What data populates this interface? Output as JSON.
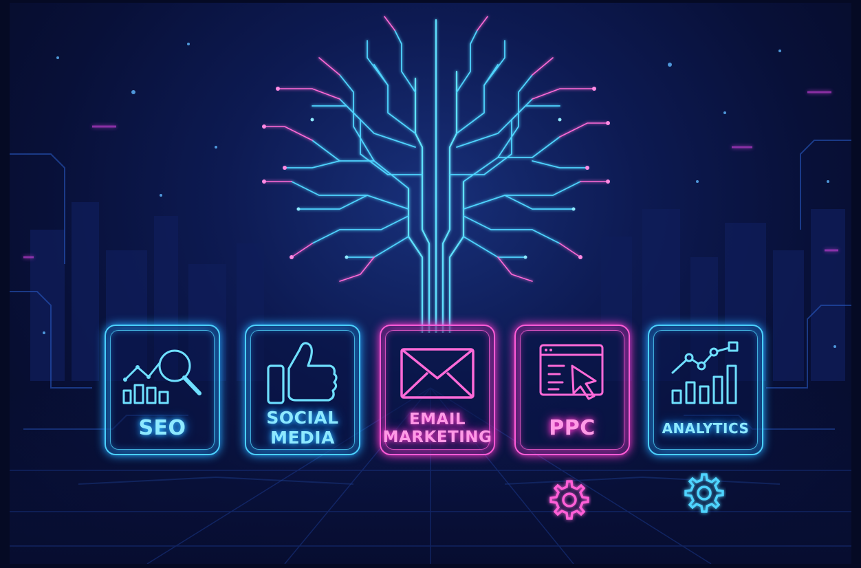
{
  "scene": {
    "subject": "digital marketing tree",
    "colors": {
      "cyan": "#4fd4ff",
      "pink": "#ff5fd7",
      "background": "#081038"
    }
  },
  "cards": [
    {
      "label": "SEO",
      "icon": "magnifier-chart-icon",
      "theme": "cyan"
    },
    {
      "label": "SOCIAL\nMEDIA",
      "icon": "thumbs-up-icon",
      "theme": "cyan"
    },
    {
      "label": "EMAIL\nMARKETING",
      "icon": "envelope-icon",
      "theme": "pink"
    },
    {
      "label": "PPC",
      "icon": "cursor-click-icon",
      "theme": "pink"
    },
    {
      "label": "ANALYTICS",
      "icon": "bar-line-chart-icon",
      "theme": "cyan"
    }
  ],
  "gears": [
    {
      "icon": "gear-icon",
      "color": "#ff5fd7"
    },
    {
      "icon": "gear-icon",
      "color": "#4fd4ff"
    }
  ]
}
